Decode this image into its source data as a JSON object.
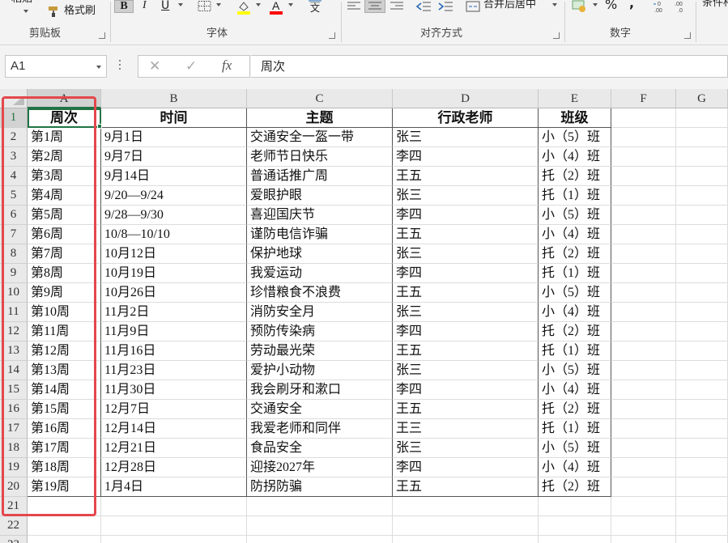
{
  "ribbon": {
    "paste_label": "粘贴",
    "format_painter_label": "格式刷",
    "groups": {
      "clipboard": "剪贴板",
      "font": "字体",
      "alignment": "对齐方式",
      "number": "数字"
    },
    "bold_glyph": "B",
    "italic_glyph": "I",
    "underline_glyph": "U",
    "wen_glyph": "文",
    "merge_center_label": "合并后居中",
    "percent_glyph": "%",
    "comma_glyph": ",",
    "conditional_label": "条件格",
    "colors": {
      "highlight": "#ffff00",
      "font_color": "#ff0000"
    }
  },
  "formula_bar": {
    "name_box": "A1",
    "cancel_glyph": "✕",
    "enter_glyph": "✓",
    "fx_glyph": "fx",
    "content": "周次"
  },
  "grid": {
    "columns": [
      {
        "letter": "A",
        "selected": true
      },
      {
        "letter": "B",
        "selected": false
      },
      {
        "letter": "C",
        "selected": false
      },
      {
        "letter": "D",
        "selected": false
      },
      {
        "letter": "E",
        "selected": false
      },
      {
        "letter": "F",
        "selected": false
      },
      {
        "letter": "G",
        "selected": false
      }
    ],
    "row_numbers": [
      "1",
      "2",
      "3",
      "4",
      "5",
      "6",
      "7",
      "8",
      "9",
      "10",
      "11",
      "12",
      "13",
      "14",
      "15",
      "16",
      "17",
      "18",
      "19",
      "20",
      "21",
      "22",
      "23"
    ],
    "header": [
      "周次",
      "时间",
      "主题",
      "行政老师",
      "班级"
    ],
    "rows": [
      [
        "第1周",
        "9月1日",
        "交通安全一盔一带",
        "张三",
        "小（5）班"
      ],
      [
        "第2周",
        "9月7日",
        "老师节日快乐",
        "李四",
        "小（4）班"
      ],
      [
        "第3周",
        "9月14日",
        "普通话推广周",
        "王五",
        "托（2）班"
      ],
      [
        "第4周",
        "9/20—9/24",
        "爱眼护眼",
        "张三",
        "托（1）班"
      ],
      [
        "第5周",
        "9/28—9/30",
        "喜迎国庆节",
        "李四",
        "小（5）班"
      ],
      [
        "第6周",
        "10/8—10/10",
        "谨防电信诈骗",
        "王五",
        "小（4）班"
      ],
      [
        "第7周",
        "10月12日",
        "保护地球",
        "张三",
        "托（2）班"
      ],
      [
        "第8周",
        "10月19日",
        "我爱运动",
        "李四",
        "托（1）班"
      ],
      [
        "第9周",
        "10月26日",
        "珍惜粮食不浪费",
        "王五",
        "小（5）班"
      ],
      [
        "第10周",
        "11月2日",
        "消防安全月",
        "张三",
        "小（4）班"
      ],
      [
        "第11周",
        "11月9日",
        "预防传染病",
        "李四",
        "托（2）班"
      ],
      [
        "第12周",
        "11月16日",
        "劳动最光荣",
        "王五",
        "托（1）班"
      ],
      [
        "第13周",
        "11月23日",
        "爱护小动物",
        "张三",
        "小（5）班"
      ],
      [
        "第14周",
        "11月30日",
        "我会刷牙和漱口",
        "李四",
        "小（4）班"
      ],
      [
        "第15周",
        "12月7日",
        "交通安全",
        "王五",
        "托（2）班"
      ],
      [
        "第16周",
        "12月14日",
        "我爱老师和同伴",
        "王三",
        "托（1）班"
      ],
      [
        "第17周",
        "12月21日",
        "食品安全",
        "张三",
        "小（5）班"
      ],
      [
        "第18周",
        "12月28日",
        "迎接2027年",
        "李四",
        "小（4）班"
      ],
      [
        "第19周",
        "1月4日",
        "防拐防骗",
        "王五",
        "托（2）班"
      ]
    ],
    "accent_color": "#217346",
    "annotation_color": "#e4474c"
  }
}
